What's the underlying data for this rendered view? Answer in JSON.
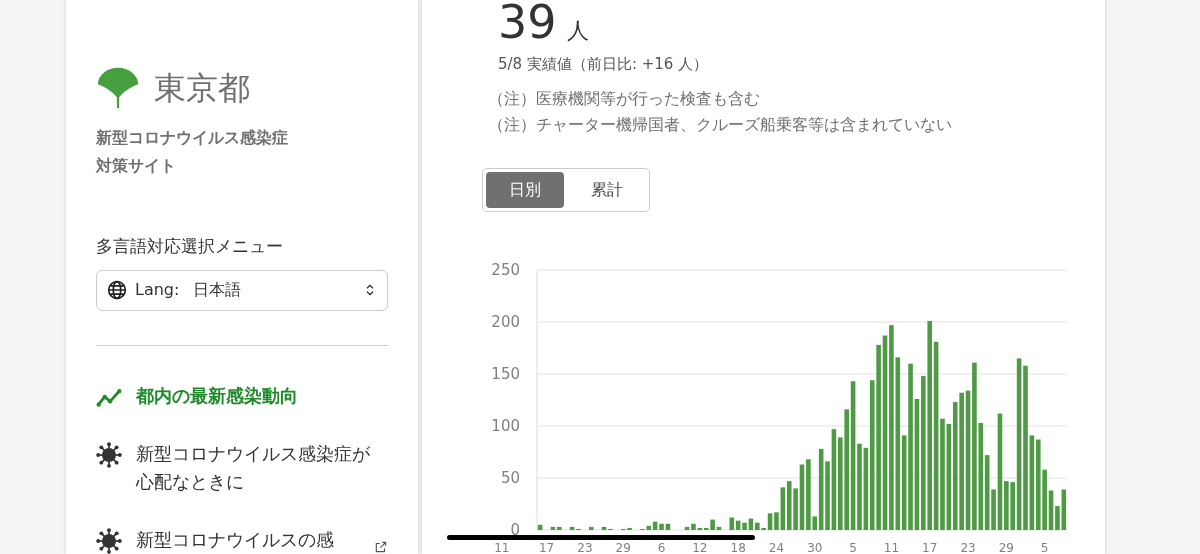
{
  "sidebar": {
    "logo_text": "東京都",
    "site_title": [
      "新型コロナウイルス感染症",
      "対策サイト"
    ],
    "language_menu": {
      "label": "多言語対応選択メニュー",
      "prefix": "Lang:",
      "value": "日本語"
    },
    "nav_items": [
      {
        "label": "都内の最新感染動向",
        "kind": "trend",
        "selected": true,
        "external": false
      },
      {
        "label": "新型コロナウイルス感染症が心配なときに",
        "kind": "virus",
        "selected": false,
        "external": false
      },
      {
        "label": "新型コロナウイルスの感",
        "kind": "virus",
        "selected": false,
        "external": true
      }
    ]
  },
  "main": {
    "count": {
      "value": "39",
      "unit": "人"
    },
    "date_note": "5/8 実績値（前日比: +16 人）",
    "notes": [
      "（注）医療機関等が行った検査も含む",
      "（注）チャーター機帰国者、クルーズ船乗客等は含まれていない"
    ],
    "toggle": [
      {
        "label": "日別",
        "selected": true
      },
      {
        "label": "累計",
        "selected": false
      }
    ],
    "chart_data": {
      "type": "bar",
      "grid": true,
      "categories": [
        null,
        "17",
        null,
        null,
        null,
        null,
        null,
        "23",
        null,
        null,
        null,
        null,
        null,
        "29",
        null,
        null,
        null,
        null,
        null,
        "6",
        null,
        null,
        null,
        null,
        null,
        "12",
        null,
        null,
        null,
        null,
        null,
        "18",
        null,
        null,
        null,
        null,
        null,
        "24",
        null,
        null,
        null,
        null,
        null,
        "30",
        null,
        null,
        null,
        null,
        null,
        "5",
        null,
        null,
        null,
        null,
        null,
        "11",
        null,
        null,
        null,
        null,
        null,
        "17",
        null,
        null,
        null,
        null,
        null,
        "23",
        null,
        null,
        null,
        null,
        null,
        "29",
        null,
        null,
        null,
        null,
        null,
        "5",
        null,
        null,
        null
      ],
      "series": [
        {
          "color": "#4f9a45",
          "values": [
            5,
            0,
            3,
            3,
            0,
            3,
            1,
            0,
            3,
            0,
            3,
            1,
            0,
            1,
            2,
            0,
            1,
            4,
            8,
            6,
            6,
            0,
            0,
            3,
            6,
            2,
            2,
            10,
            3,
            0,
            12,
            9,
            7,
            11,
            7,
            2,
            16,
            17,
            41,
            47,
            40,
            63,
            68,
            13,
            78,
            66,
            97,
            89,
            116,
            143,
            83,
            79,
            144,
            178,
            187,
            197,
            166,
            91,
            160,
            126,
            148,
            201,
            181,
            107,
            102,
            123,
            132,
            134,
            161,
            103,
            72,
            39,
            112,
            47,
            46,
            165,
            158,
            91,
            87,
            58,
            38,
            23,
            39
          ]
        }
      ],
      "ylim": [
        0,
        250
      ],
      "yticks": [
        0,
        50,
        100,
        150,
        200,
        250
      ],
      "annotations": [
        {
          "text": "11"
        }
      ]
    }
  }
}
